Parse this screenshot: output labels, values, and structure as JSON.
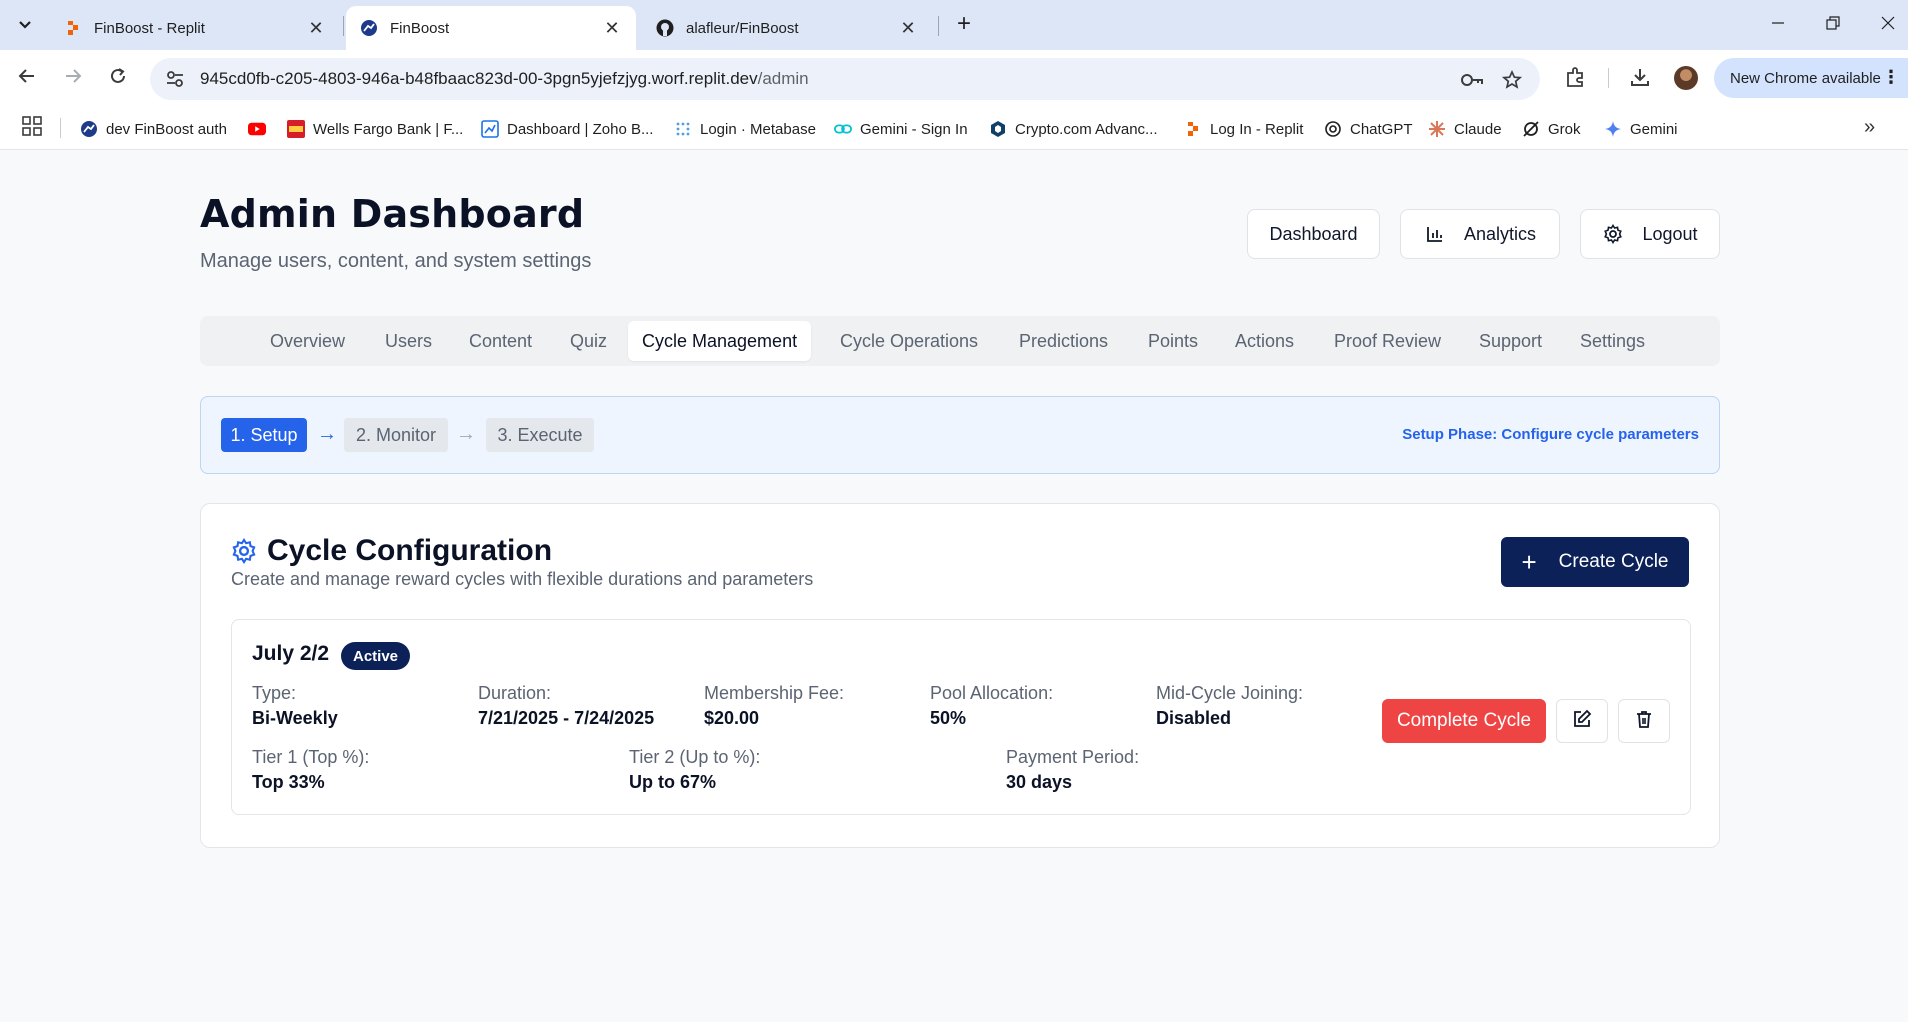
{
  "browser": {
    "tabs": [
      {
        "title": "FinBoost - Replit",
        "icon": "replit-icon"
      },
      {
        "title": "FinBoost",
        "icon": "finboost-icon"
      },
      {
        "title": "alafleur/FinBoost",
        "icon": "github-icon"
      }
    ],
    "url_host": "945cd0fb-c205-4803-946a-b48fbaac823d-00-3pgn5yjefzjyg.worf.replit.dev",
    "url_path": "/admin",
    "update_label": "New Chrome available",
    "bookmarks": [
      {
        "label": "dev FinBoost auth"
      },
      {
        "label": ""
      },
      {
        "label": "Wells Fargo Bank | F..."
      },
      {
        "label": "Dashboard | Zoho B..."
      },
      {
        "label": "Login · Metabase"
      },
      {
        "label": "Gemini - Sign In"
      },
      {
        "label": "Crypto.com Advanc..."
      },
      {
        "label": "Log In - Replit"
      },
      {
        "label": "ChatGPT"
      },
      {
        "label": "Claude"
      },
      {
        "label": "Grok"
      },
      {
        "label": "Gemini"
      }
    ]
  },
  "header": {
    "title": "Admin Dashboard",
    "subtitle": "Manage users, content, and system settings",
    "buttons": {
      "dashboard": "Dashboard",
      "analytics": "Analytics",
      "logout": "Logout"
    }
  },
  "nav_tabs": [
    "Overview",
    "Users",
    "Content",
    "Quiz",
    "Cycle Management",
    "Cycle Operations",
    "Predictions",
    "Points",
    "Actions",
    "Proof Review",
    "Support",
    "Settings"
  ],
  "active_tab": "Cycle Management",
  "phases": {
    "steps": [
      "1. Setup",
      "2. Monitor",
      "3. Execute"
    ],
    "current": "1. Setup",
    "arrow": "→",
    "note": "Setup Phase: Configure cycle parameters"
  },
  "config": {
    "title": "Cycle Configuration",
    "subtitle": "Create and manage reward cycles with flexible durations and parameters",
    "create_label": "Create Cycle"
  },
  "cycle": {
    "name": "July 2/2",
    "status": "Active",
    "fields": {
      "type": {
        "label": "Type:",
        "value": "Bi-Weekly"
      },
      "duration": {
        "label": "Duration:",
        "value": "7/21/2025 - 7/24/2025"
      },
      "fee": {
        "label": "Membership Fee:",
        "value": "$20.00"
      },
      "pool": {
        "label": "Pool Allocation:",
        "value": "50%"
      },
      "mid": {
        "label": "Mid-Cycle Joining:",
        "value": "Disabled"
      },
      "tier1": {
        "label": "Tier 1 (Top %):",
        "value": "Top 33%"
      },
      "tier2": {
        "label": "Tier 2 (Up to %):",
        "value": "Up to 67%"
      },
      "period": {
        "label": "Payment Period:",
        "value": "30 days"
      }
    },
    "complete_label": "Complete Cycle"
  },
  "colors": {
    "primary_blue": "#2563eb",
    "navy": "#0b2158",
    "danger": "#ef4444"
  }
}
